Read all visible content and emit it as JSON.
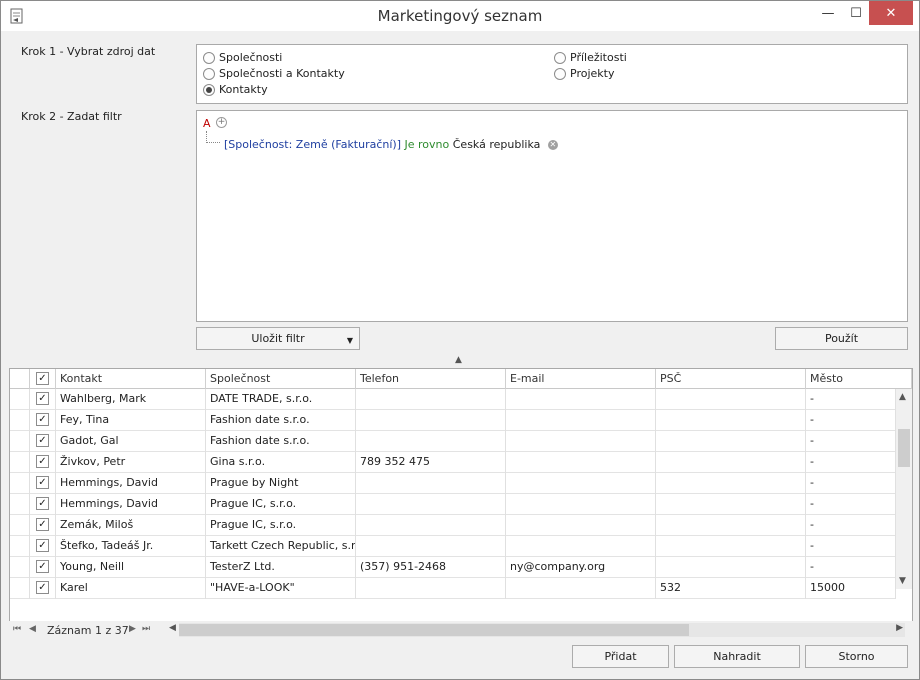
{
  "window": {
    "title": "Marketingový seznam",
    "minimize": "—",
    "maximize": "☐",
    "close": "✕"
  },
  "step1": {
    "label": "Krok 1 - Vybrat zdroj dat",
    "options": [
      {
        "label": "Společnosti",
        "checked": false
      },
      {
        "label": "Společnosti a Kontakty",
        "checked": false
      },
      {
        "label": "Kontakty",
        "checked": true
      },
      {
        "label": "Příležitosti",
        "checked": false
      },
      {
        "label": "Projekty",
        "checked": false
      }
    ]
  },
  "step2": {
    "label": "Krok 2 - Zadat filtr",
    "root": "A",
    "condition": {
      "field": "[Společnost: Země (Fakturační)]",
      "operator": "Je rovno",
      "value": "Česká republika"
    }
  },
  "buttons": {
    "save_filter": "Uložit filtr",
    "apply": "Použít",
    "add": "Přidat",
    "replace": "Nahradit",
    "cancel": "Storno"
  },
  "grid": {
    "columns": [
      "Kontakt",
      "Společnost",
      "Telefon",
      "E-mail",
      "PSČ",
      "Město"
    ],
    "rows": [
      {
        "contact": "Wahlberg, Mark",
        "company": "DATE TRADE, s.r.o.",
        "phone": "",
        "email": "",
        "zip": "",
        "city": "-"
      },
      {
        "contact": "Fey, Tina",
        "company": "Fashion date s.r.o.",
        "phone": "",
        "email": "",
        "zip": "",
        "city": "-"
      },
      {
        "contact": "Gadot, Gal",
        "company": "Fashion date s.r.o.",
        "phone": "",
        "email": "",
        "zip": "",
        "city": "-"
      },
      {
        "contact": "Živkov, Petr",
        "company": "Gina s.r.o.",
        "phone": "789 352 475",
        "email": "",
        "zip": "",
        "city": "-"
      },
      {
        "contact": "Hemmings, David",
        "company": "Prague by Night",
        "phone": "",
        "email": "",
        "zip": "",
        "city": "-"
      },
      {
        "contact": "Hemmings, David",
        "company": "Prague IC, s.r.o.",
        "phone": "",
        "email": "",
        "zip": "",
        "city": "-"
      },
      {
        "contact": "Zemák, Miloš",
        "company": "Prague IC, s.r.o.",
        "phone": "",
        "email": "",
        "zip": "",
        "city": "-"
      },
      {
        "contact": "Štefko, Tadeáš Jr.",
        "company": "Tarkett Czech Republic, s.r....",
        "phone": "",
        "email": "",
        "zip": "",
        "city": "-"
      },
      {
        "contact": "Young, Neill",
        "company": "TesterZ Ltd.",
        "phone": "(357) 951-2468",
        "email": "ny@company.org",
        "zip": "",
        "city": "-"
      },
      {
        "contact": "Karel",
        "company": "\"HAVE-a-LOOK\"",
        "phone": "",
        "email": "",
        "zip": "532",
        "city": "15000"
      }
    ]
  },
  "navigator": {
    "record_text": "Záznam 1 z 37"
  }
}
